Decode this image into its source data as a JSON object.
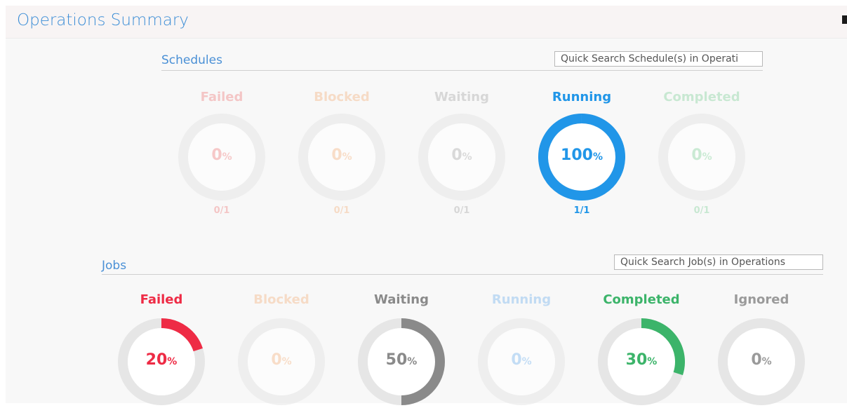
{
  "page": {
    "title": "Operations Summary"
  },
  "schedules": {
    "label": "Schedules",
    "search_placeholder": "Quick Search Schedule(s) in Operati",
    "cards": [
      {
        "key": "failed",
        "label": "Failed",
        "percent": 0,
        "count": "0/1",
        "color": "#f08a8a",
        "dimmed": true
      },
      {
        "key": "blocked",
        "label": "Blocked",
        "percent": 0,
        "count": "0/1",
        "color": "#f5b98a",
        "dimmed": true
      },
      {
        "key": "waiting",
        "label": "Waiting",
        "percent": 0,
        "count": "0/1",
        "color": "#b0b0b0",
        "dimmed": true
      },
      {
        "key": "running",
        "label": "Running",
        "percent": 100,
        "count": "1/1",
        "color": "#2196e8",
        "dimmed": false
      },
      {
        "key": "completed",
        "label": "Completed",
        "percent": 0,
        "count": "0/1",
        "color": "#8fd4a4",
        "dimmed": true
      }
    ]
  },
  "jobs": {
    "label": "Jobs",
    "search_placeholder": "Quick Search Job(s) in Operations",
    "cards": [
      {
        "key": "failed",
        "label": "Failed",
        "percent": 20,
        "color": "#ee2b45",
        "dimmed": false
      },
      {
        "key": "blocked",
        "label": "Blocked",
        "percent": 0,
        "color": "#f5b98a",
        "dimmed": true
      },
      {
        "key": "waiting",
        "label": "Waiting",
        "percent": 50,
        "color": "#8a8a8a",
        "dimmed": false
      },
      {
        "key": "running",
        "label": "Running",
        "percent": 0,
        "color": "#7fb8ee",
        "dimmed": true
      },
      {
        "key": "completed",
        "label": "Completed",
        "percent": 30,
        "color": "#3cb46a",
        "dimmed": false
      },
      {
        "key": "ignored",
        "label": "Ignored",
        "percent": 0,
        "color": "#9a9a9a",
        "dimmed": false
      }
    ]
  },
  "percent_suffix": "%"
}
